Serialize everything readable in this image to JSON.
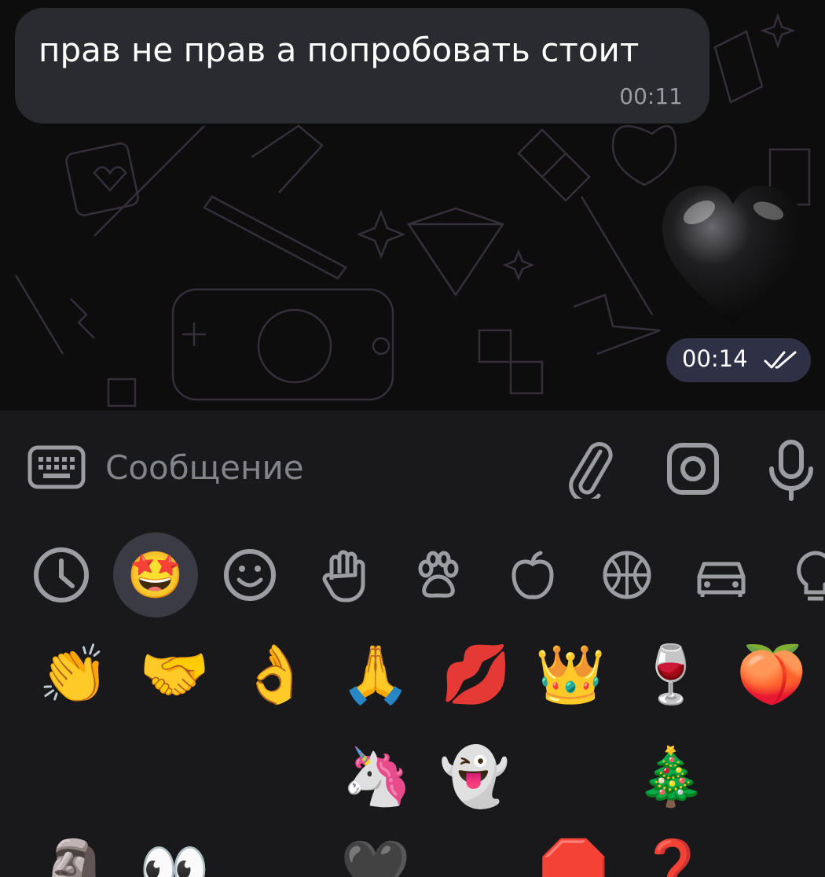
{
  "chat": {
    "incoming_message": {
      "text": "прав не прав а попробовать стоит",
      "time": "00:11"
    },
    "outgoing_sticker": {
      "emoji_name": "black-heart",
      "time": "00:14",
      "status_icon": "double-check-icon"
    }
  },
  "composer": {
    "placeholder": "Сообщение",
    "keyboard_icon": "keyboard-icon",
    "attach_icon": "paperclip-icon",
    "camera_icon": "camera-icon",
    "mic_icon": "microphone-icon"
  },
  "emoji_categories": {
    "selected": "stickers-emoji",
    "items": [
      {
        "name": "recent",
        "icon": "clock-icon"
      },
      {
        "name": "animated",
        "emoji": "🤩"
      },
      {
        "name": "smileys",
        "icon": "smiley-icon"
      },
      {
        "name": "people",
        "icon": "hand-icon"
      },
      {
        "name": "animals",
        "icon": "paw-icon"
      },
      {
        "name": "food",
        "icon": "apple-icon"
      },
      {
        "name": "activity",
        "icon": "ball-icon"
      },
      {
        "name": "travel",
        "icon": "car-icon"
      },
      {
        "name": "objects",
        "icon": "bulb-icon"
      }
    ]
  },
  "emoji_grid": {
    "row1": [
      "👏",
      "🤝",
      "👌",
      "🙏",
      "💋",
      "👑",
      "🍷",
      "🍑"
    ],
    "row2": [
      "🦄",
      "👻",
      "🎄"
    ],
    "row3": [
      "🗿",
      "👀",
      "🖤",
      "🛑",
      "❓"
    ]
  },
  "colors": {
    "bubble_incoming": "#2a2b31",
    "time_pill": "#2e3046",
    "panel_bg": "#19191b",
    "icon_gray": "#9c9ca3",
    "selected_category": "#3b3b45"
  }
}
